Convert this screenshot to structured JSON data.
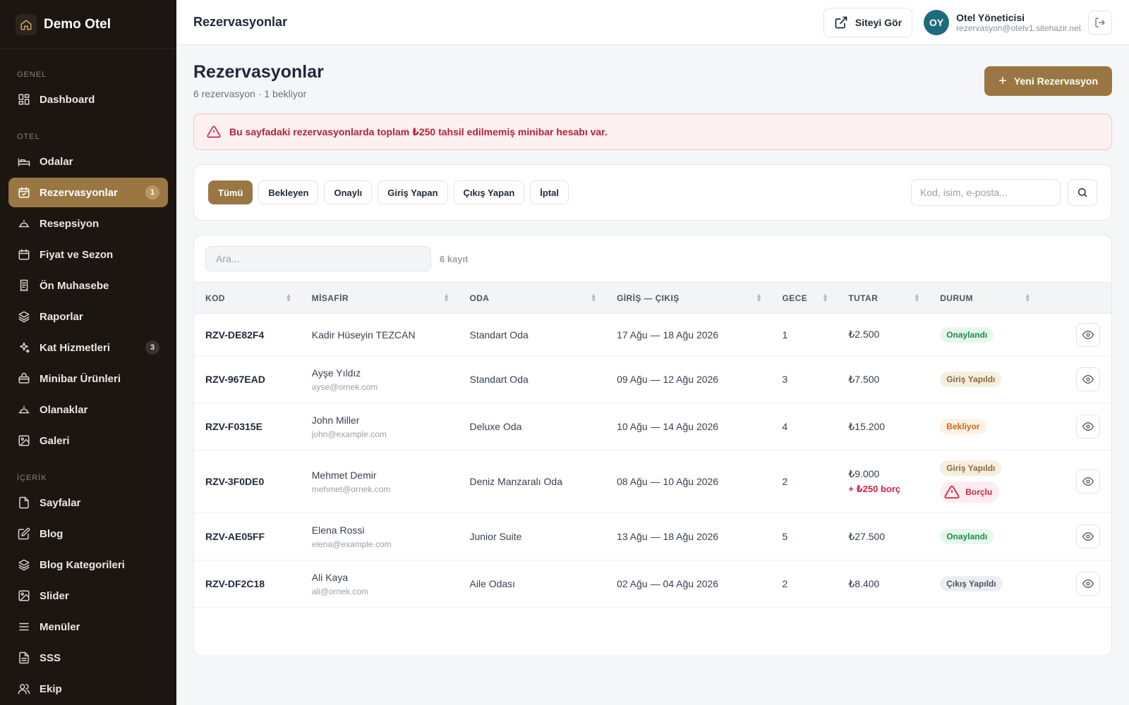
{
  "brand": {
    "name": "Demo Otel"
  },
  "sidebar": {
    "sections": [
      {
        "label": "GENEL",
        "items": [
          {
            "label": "Dashboard",
            "icon": "dashboard-icon"
          }
        ]
      },
      {
        "label": "OTEL",
        "items": [
          {
            "label": "Odalar",
            "icon": "bed-icon"
          },
          {
            "label": "Rezervasyonlar",
            "icon": "calendar-check-icon",
            "badge": "1",
            "active": true
          },
          {
            "label": "Resepsiyon",
            "icon": "bell-icon"
          },
          {
            "label": "Fiyat ve Sezon",
            "icon": "calendar-icon"
          },
          {
            "label": "Ön Muhasebe",
            "icon": "receipt-icon"
          },
          {
            "label": "Raporlar",
            "icon": "layers-icon"
          },
          {
            "label": "Kat Hizmetleri",
            "icon": "sparkles-icon",
            "badge": "3"
          },
          {
            "label": "Minibar Ürünleri",
            "icon": "cooler-icon"
          },
          {
            "label": "Olanaklar",
            "icon": "service-bell-icon"
          },
          {
            "label": "Galeri",
            "icon": "image-icon"
          }
        ]
      },
      {
        "label": "İÇERİK",
        "items": [
          {
            "label": "Sayfalar",
            "icon": "file-icon"
          },
          {
            "label": "Blog",
            "icon": "edit-icon"
          },
          {
            "label": "Blog Kategorileri",
            "icon": "layers-icon"
          },
          {
            "label": "Slider",
            "icon": "image-icon"
          },
          {
            "label": "Menüler",
            "icon": "menu-icon"
          },
          {
            "label": "SSS",
            "icon": "file-text-icon"
          },
          {
            "label": "Ekip",
            "icon": "users-icon"
          }
        ]
      }
    ]
  },
  "topbar": {
    "title": "Rezervasyonlar",
    "site_button": "Siteyi Gör",
    "user_initials": "OY",
    "user_name": "Otel Yöneticisi",
    "user_email": "rezervasyon@otelv1.sitehazir.net"
  },
  "page": {
    "title": "Rezervasyonlar",
    "subtitle": "6 rezervasyon · 1 bekliyor",
    "new_button": "Yeni Rezervasyon"
  },
  "alert": {
    "text": "Bu sayfadaki rezervasyonlarda toplam ₺250 tahsil edilmemiş minibar hesabı var."
  },
  "filters": {
    "chips": [
      "Tümü",
      "Bekleyen",
      "Onaylı",
      "Giriş Yapan",
      "Çıkış Yapan",
      "İptal"
    ],
    "active": "Tümü",
    "search_placeholder": "Kod, isim, e-posta..."
  },
  "table": {
    "search_placeholder": "Ara...",
    "record_count": "6 kayıt",
    "columns": [
      "KOD",
      "MİSAFİR",
      "ODA",
      "GİRİŞ — ÇIKIŞ",
      "GECE",
      "TUTAR",
      "DURUM"
    ],
    "rows": [
      {
        "code": "RZV-DE82F4",
        "guest": "Kadir Hüseyin TEZCAN",
        "email": "",
        "room": "Standart Oda",
        "dates": "17 Ağu — 18 Ağu 2026",
        "nights": "1",
        "amount": "₺2.500",
        "debt": "",
        "status": "Onaylandı",
        "status_type": "green",
        "debt_badge": ""
      },
      {
        "code": "RZV-967EAD",
        "guest": "Ayşe Yıldız",
        "email": "ayse@ornek.com",
        "room": "Standart Oda",
        "dates": "09 Ağu — 12 Ağu 2026",
        "nights": "3",
        "amount": "₺7.500",
        "debt": "",
        "status": "Giriş Yapıldı",
        "status_type": "tan",
        "debt_badge": ""
      },
      {
        "code": "RZV-F0315E",
        "guest": "John Miller",
        "email": "john@example.com",
        "room": "Deluxe Oda",
        "dates": "10 Ağu — 14 Ağu 2026",
        "nights": "4",
        "amount": "₺15.200",
        "debt": "",
        "status": "Bekliyor",
        "status_type": "orange",
        "debt_badge": ""
      },
      {
        "code": "RZV-3F0DE0",
        "guest": "Mehmet Demir",
        "email": "mehmet@ornek.com",
        "room": "Deniz Manzaralı Oda",
        "dates": "08 Ağu — 10 Ağu 2026",
        "nights": "2",
        "amount": "₺9.000",
        "debt": "+ ₺250 borç",
        "status": "Giriş Yapıldı",
        "status_type": "tan",
        "debt_badge": "Borçlu"
      },
      {
        "code": "RZV-AE05FF",
        "guest": "Elena Rossi",
        "email": "elena@example.com",
        "room": "Junior Suite",
        "dates": "13 Ağu — 18 Ağu 2026",
        "nights": "5",
        "amount": "₺27.500",
        "debt": "",
        "status": "Onaylandı",
        "status_type": "green",
        "debt_badge": ""
      },
      {
        "code": "RZV-DF2C18",
        "guest": "Ali Kaya",
        "email": "ali@ornek.com",
        "room": "Aile Odası",
        "dates": "02 Ağu — 04 Ağu 2026",
        "nights": "2",
        "amount": "₺8.400",
        "debt": "",
        "status": "Çıkış Yapıldı",
        "status_type": "gray",
        "debt_badge": ""
      }
    ]
  },
  "colors": {
    "accent": "#9a7742",
    "sidebar_bg": "#1c1612",
    "danger": "#cf2446",
    "avatar": "#1d6c7e"
  }
}
